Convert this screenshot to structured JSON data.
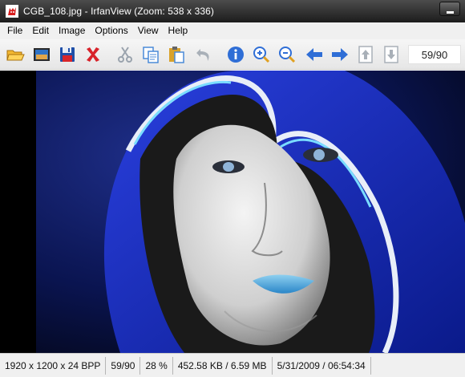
{
  "window": {
    "title": "CGB_108.jpg - IrfanView (Zoom: 538 x 336)",
    "app_icon": "irfanview-red-cat-icon"
  },
  "menu": {
    "items": [
      "File",
      "Edit",
      "Image",
      "Options",
      "View",
      "Help"
    ]
  },
  "toolbar": {
    "buttons": [
      {
        "name": "open-folder-icon",
        "color": "#e8a317"
      },
      {
        "name": "slideshow-icon",
        "color": "#1f5fb0"
      },
      {
        "name": "save-floppy-icon",
        "color": "#1f4fa8"
      },
      {
        "name": "delete-x-icon",
        "color": "#d8232a"
      },
      {
        "name": "cut-scissors-icon",
        "color": "#9aa3ad"
      },
      {
        "name": "copy-icon",
        "color": "#4a8ad8"
      },
      {
        "name": "paste-icon",
        "color": "#d9a22a"
      },
      {
        "name": "undo-icon",
        "color": "#a9b0b8"
      },
      {
        "name": "info-icon",
        "color": "#2f6ed6"
      },
      {
        "name": "zoom-in-icon",
        "color": "#2f6ed6"
      },
      {
        "name": "zoom-out-icon",
        "color": "#2f6ed6"
      },
      {
        "name": "previous-arrow-icon",
        "color": "#2f6ed6"
      },
      {
        "name": "next-arrow-icon",
        "color": "#2f6ed6"
      },
      {
        "name": "page-up-icon",
        "color": "#a9b0b8"
      },
      {
        "name": "page-down-icon",
        "color": "#a9b0b8"
      }
    ],
    "counter": "59/90"
  },
  "image": {
    "description_icon": "hooded-woman-artwork",
    "accent": "#1f3fd0",
    "background": "#0a1440"
  },
  "status": {
    "resolution": "1920 x 1200 x 24 BPP",
    "index": "59/90",
    "zoom": "28 %",
    "size": "452.58 KB / 6.59 MB",
    "datetime": "5/31/2009 / 06:54:34"
  }
}
